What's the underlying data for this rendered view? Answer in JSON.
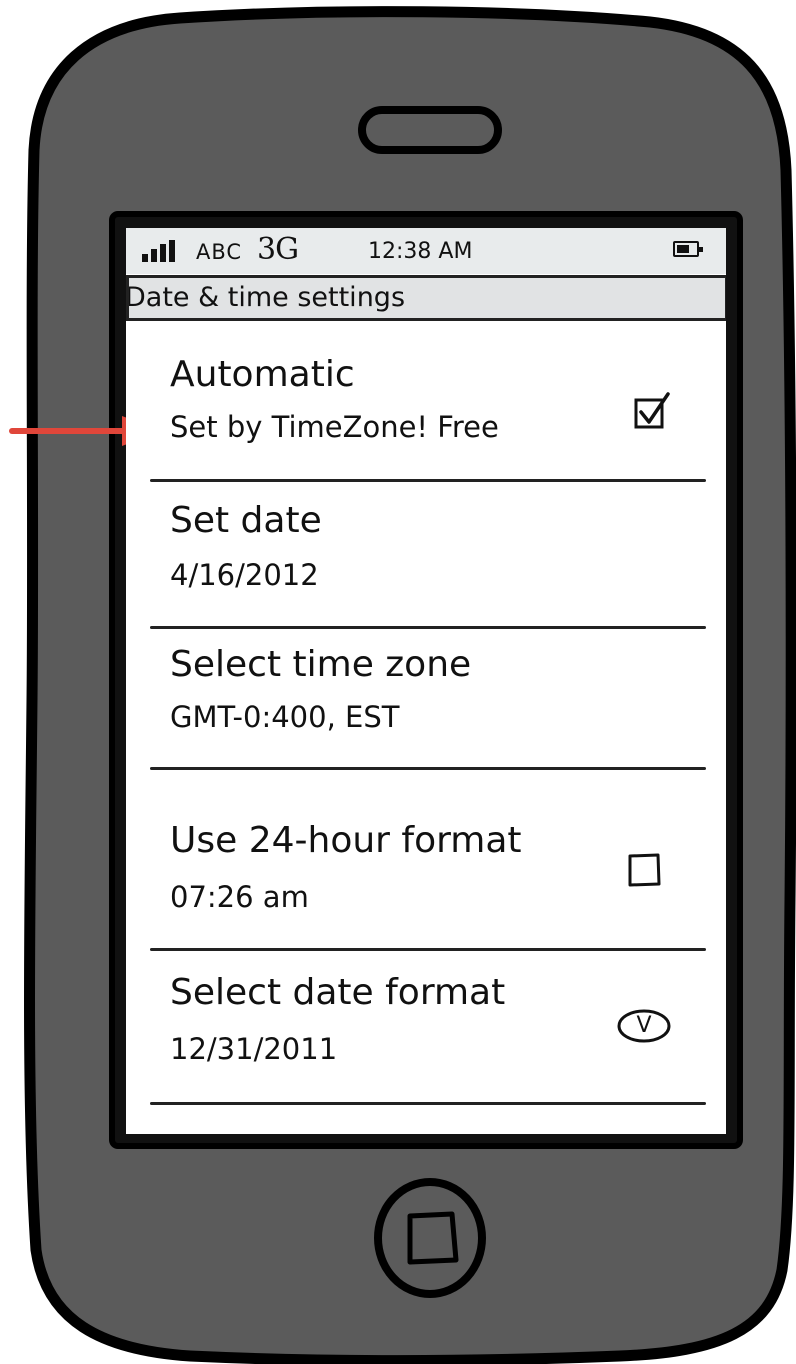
{
  "status_bar": {
    "signal_icon": "signal-bars-icon",
    "carrier": "ABC",
    "network": "3G",
    "time": "12:38 AM",
    "battery_icon": "battery-icon"
  },
  "title_bar": {
    "title": "Date & time settings"
  },
  "settings": [
    {
      "title": "Automatic",
      "subtitle": "Set by TimeZone! Free",
      "control": "checkbox",
      "checked": true
    },
    {
      "title": "Set date",
      "subtitle": "4/16/2012",
      "control": "none"
    },
    {
      "title": "Select time zone",
      "subtitle": "GMT-0:400, EST",
      "control": "none"
    },
    {
      "title": "Use 24-hour format",
      "subtitle": "07:26 am",
      "control": "checkbox",
      "checked": false
    },
    {
      "title": "Select date format",
      "subtitle": "12/31/2011",
      "control": "dropdown",
      "control_glyph": "V"
    }
  ],
  "annotation": {
    "arrow_color": "#e0463a",
    "arrow_icon": "arrow-right-icon"
  },
  "colors": {
    "phone_body": "#5b5b5b",
    "screen": "#ffffff",
    "status_bar": "#e8ebec",
    "title_bar": "#e1e3e4",
    "ink": "#111111"
  }
}
